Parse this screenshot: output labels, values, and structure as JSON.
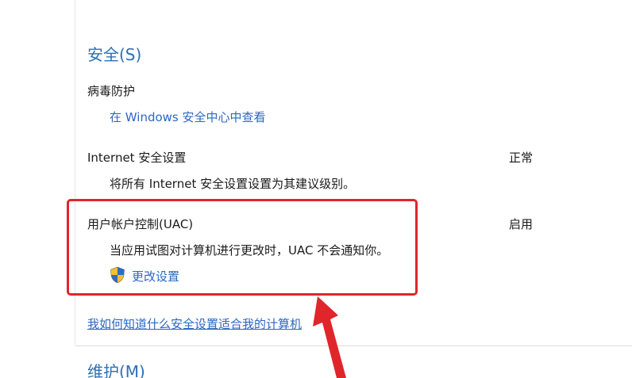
{
  "security": {
    "title": "安全(S)",
    "virus": {
      "title": "病毒防护",
      "link": "在 Windows 安全中心中查看"
    },
    "internet": {
      "title": "Internet 安全设置",
      "status": "正常",
      "desc": "将所有 Internet 安全设置设置为其建议级别。"
    },
    "uac": {
      "title": "用户帐户控制(UAC)",
      "status": "启用",
      "desc": "当应用试图对计算机进行更改时，UAC 不会通知你。",
      "link": "更改设置",
      "icon": "uac-shield-icon"
    },
    "help_link": "我如何知道什么安全设置适合我的计算机"
  },
  "maintenance": {
    "title": "维护(M)"
  },
  "annotation": {
    "color": "#e0252b"
  }
}
